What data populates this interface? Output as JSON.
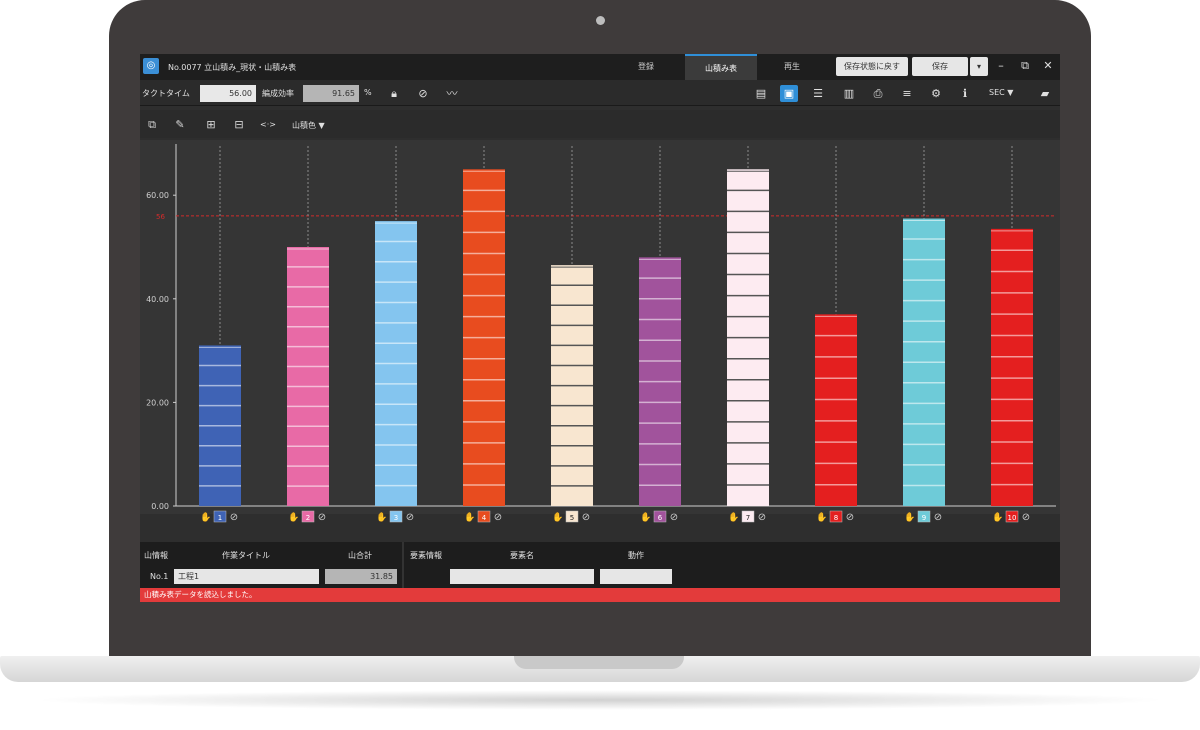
{
  "window": {
    "title": "No.0077 立山積み_現状・山積み表",
    "tabs": [
      {
        "label": "登録",
        "active": false
      },
      {
        "label": "山積み表",
        "active": true
      },
      {
        "label": "再生",
        "active": false
      }
    ],
    "restore_button": "保存状態に戻す",
    "save_button": "保存",
    "save_dropdown": "▾",
    "minimize": "–",
    "restore": "⧉",
    "close": "✕"
  },
  "toolbar": {
    "takt_label": "タクトタイム",
    "takt_value": "56.00",
    "efficiency_label": "編成効率",
    "efficiency_value": "91.65",
    "efficiency_unit": "%",
    "unit_select": "SEC ▼"
  },
  "toolbar2": {
    "range_icon": "<·>",
    "color_select": "山積色 ▼"
  },
  "chart_data": {
    "type": "bar",
    "title": "",
    "ylim": [
      0,
      70
    ],
    "ytick_labels": [
      "0.00",
      "20.00",
      "40.00",
      "60.00"
    ],
    "takt_line": 56,
    "takt_line_label": "56",
    "stations": [
      {
        "id": "1",
        "value": 31,
        "color": "#3f63b5"
      },
      {
        "id": "2",
        "value": 50,
        "color": "#e86aa6"
      },
      {
        "id": "3",
        "value": 55,
        "color": "#84c5ef"
      },
      {
        "id": "4",
        "value": 65,
        "color": "#e84c1f"
      },
      {
        "id": "5",
        "value": 46.5,
        "color": "#f8e6d0"
      },
      {
        "id": "6",
        "value": 48,
        "color": "#a1539c"
      },
      {
        "id": "7",
        "value": 65,
        "color": "#fdebf1"
      },
      {
        "id": "8",
        "value": 37,
        "color": "#e41f1f"
      },
      {
        "id": "9",
        "value": 55.5,
        "color": "#6ecbd8"
      },
      {
        "id": "10",
        "value": 53.5,
        "color": "#e41f1f"
      }
    ]
  },
  "bottom": {
    "section_label": "山情報",
    "work_title_label": "作業タイトル",
    "total_label": "山合計",
    "element_section_label": "要素情報",
    "element_name_label": "要素名",
    "action_label": "動作",
    "row_no": "No.1",
    "process_name": "工程1",
    "total_value": "31.85",
    "element_name": "",
    "action_value": ""
  },
  "status": {
    "message": "山積み表データを読込しました。"
  },
  "colors": {
    "accent": "#2f8fd8",
    "takt_line": "#d22b2b",
    "status_bar": "#e33b3b"
  }
}
